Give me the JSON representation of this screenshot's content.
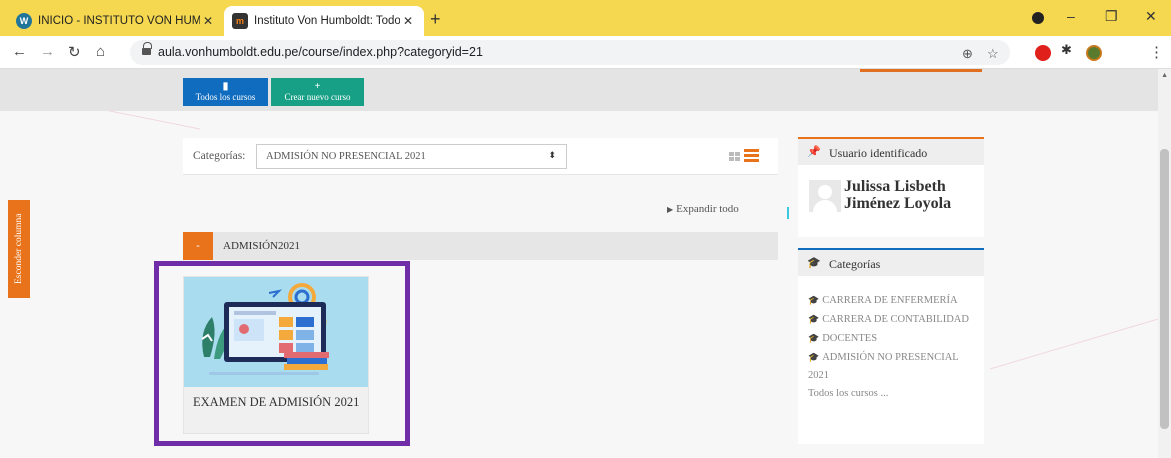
{
  "browser": {
    "tabs": [
      {
        "title": "INICIO - INSTITUTO VON HUMBO",
        "active": false,
        "favicon": "wordpress-icon"
      },
      {
        "title": "Instituto Von Humboldt: Todos lo",
        "active": true,
        "favicon": "moodle-icon"
      }
    ],
    "new_tab": "+",
    "url": "aula.vonhumboldt.edu.pe/course/index.php?categoryid=21",
    "window_controls": [
      "–",
      "❐",
      "✕"
    ]
  },
  "page": {
    "buttons": {
      "all_courses": "Todos los cursos",
      "new_course": "Crear nuevo curso"
    },
    "hide_column": "Esconder columna",
    "category_label": "Categorías:",
    "category_selected": "ADMISIÓN NO PRESENCIAL 2021",
    "expand_all": "Expandir todo",
    "section": {
      "toggle": "-",
      "title": "ADMISIÓN2021"
    },
    "course": {
      "name": "EXAMEN DE ADMISIÓN 2021"
    }
  },
  "blocks": {
    "user": {
      "title": "Usuario identificado",
      "name": "Julissa Lisbeth Jiménez Loyola"
    },
    "categories": {
      "title": "Categorías",
      "items": [
        "CARRERA DE ENFERMERÍA",
        "CARRERA DE CONTABILIDAD",
        "DOCENTES",
        "ADMISIÓN NO PRESENCIAL 2021"
      ],
      "all_courses": "Todos los cursos ..."
    }
  },
  "colors": {
    "accent_orange": "#e8731a",
    "moodle_blue": "#0f6cbf",
    "green": "#17a085",
    "tabbar_yellow": "#f5d84f",
    "highlight_purple": "#6f2da8"
  }
}
